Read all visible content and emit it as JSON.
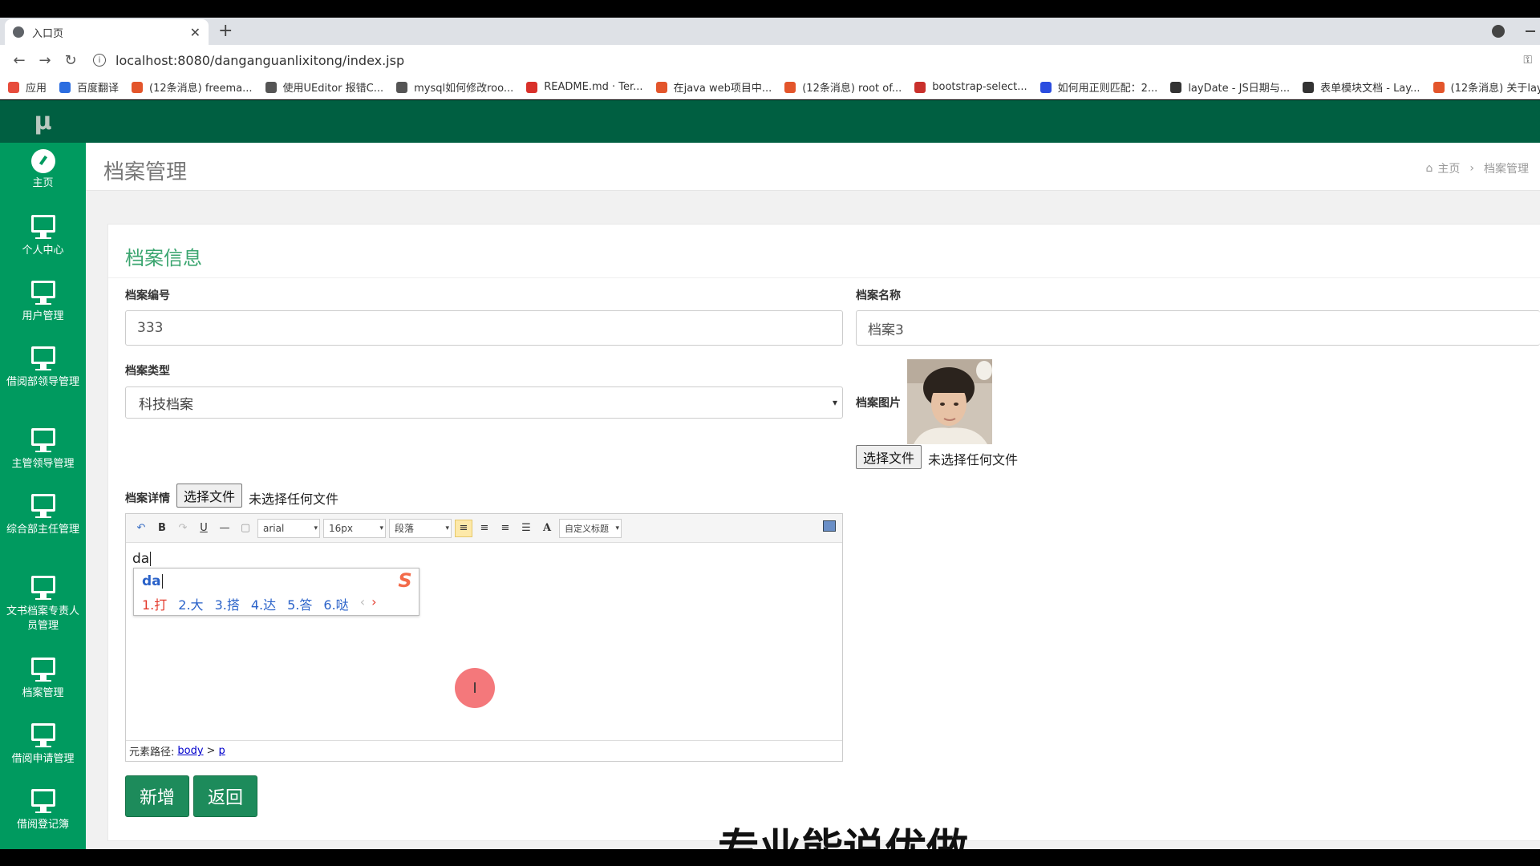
{
  "browser": {
    "tab_title": "入口页",
    "url": "localhost:8080/danganguanlixitong/index.jsp",
    "bookmarks": [
      {
        "label": "应用",
        "color": "#e74c3c"
      },
      {
        "label": "百度翻译",
        "color": "#2b6de0"
      },
      {
        "label": "(12条消息) freema...",
        "color": "#e3552b"
      },
      {
        "label": "使用UEditor 报错C...",
        "color": "#555555"
      },
      {
        "label": "mysql如何修改roo...",
        "color": "#555555"
      },
      {
        "label": "README.md · Ter...",
        "color": "#d9302a"
      },
      {
        "label": "在java web项目中...",
        "color": "#e3552b"
      },
      {
        "label": "(12条消息) root of...",
        "color": "#e3552b"
      },
      {
        "label": "bootstrap-select...",
        "color": "#c9302c"
      },
      {
        "label": "如何用正则匹配：2...",
        "color": "#2b4de0"
      },
      {
        "label": "layDate - JS日期与...",
        "color": "#333333"
      },
      {
        "label": "表单模块文档 - Lay...",
        "color": "#333333"
      },
      {
        "label": "(12条消息) 关于lay...",
        "color": "#e3552b"
      }
    ]
  },
  "app": {
    "logo_text": "μ",
    "sidebar": [
      {
        "label": "主页",
        "icon": "dashboard-icon"
      },
      {
        "label": "个人中心",
        "icon": "monitor-icon"
      },
      {
        "label": "用户管理",
        "icon": "monitor-icon"
      },
      {
        "label": "借阅部领导管理",
        "icon": "monitor-icon"
      },
      {
        "label": "主管领导管理",
        "icon": "monitor-icon"
      },
      {
        "label": "综合部主任管理",
        "icon": "monitor-icon"
      },
      {
        "label": "文书档案专责人员管理",
        "icon": "monitor-icon"
      },
      {
        "label": "档案管理",
        "icon": "monitor-icon"
      },
      {
        "label": "借阅申请管理",
        "icon": "monitor-icon"
      },
      {
        "label": "借阅登记簿",
        "icon": "monitor-icon"
      }
    ],
    "header": {
      "title": "档案管理",
      "breadcrumb_home": "主页",
      "breadcrumb_current": "档案管理"
    }
  },
  "form": {
    "panel_title": "档案信息",
    "id_label": "档案编号",
    "id_value": "333",
    "name_label": "档案名称",
    "name_value": "档案3",
    "type_label": "档案类型",
    "type_value": "科技档案",
    "image_label": "档案图片",
    "file_button": "选择文件",
    "no_file": "未选择任何文件",
    "detail_label": "档案详情",
    "submit_button": "新增",
    "back_button": "返回"
  },
  "editor": {
    "font_family": "arial",
    "font_size": "16px",
    "paragraph": "段落",
    "custom_title": "自定义标题",
    "content": "da",
    "path_label": "元素路径:",
    "path_body": "body",
    "path_sep": ">",
    "path_p": "p"
  },
  "ime": {
    "composition": "da",
    "candidates": [
      "1.打",
      "2.大",
      "3.搭",
      "4.达",
      "5.答",
      "6.哒"
    ]
  },
  "subtitle": "专业能说优做"
}
